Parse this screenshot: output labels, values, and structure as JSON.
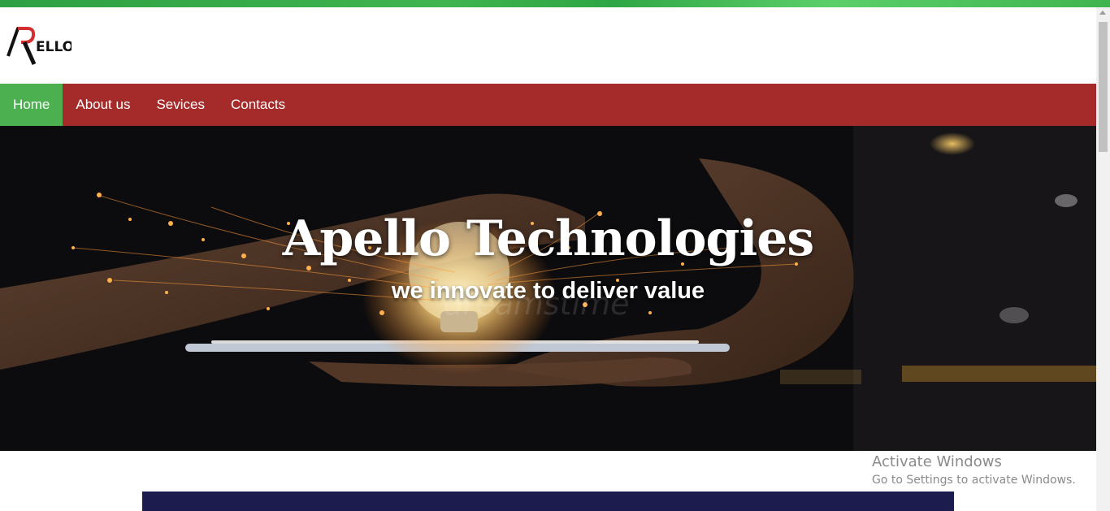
{
  "brand": {
    "logo_text": "ELLO",
    "logo_mark": "A"
  },
  "nav": {
    "items": [
      {
        "label": "Home",
        "active": true
      },
      {
        "label": "About us",
        "active": false
      },
      {
        "label": "Sevices",
        "active": false
      },
      {
        "label": "Contacts",
        "active": false
      }
    ]
  },
  "hero": {
    "title": "Apello Technologies",
    "subtitle": "we innovate to deliver value",
    "watermark_text": "dreamstime"
  },
  "os_watermark": {
    "title": "Activate Windows",
    "subtitle": "Go to Settings to activate Windows."
  },
  "colors": {
    "top_strip": "#3fb44f",
    "nav_background": "#a52a2a",
    "nav_active": "#4caf50",
    "panel": "#1c1c4e"
  }
}
